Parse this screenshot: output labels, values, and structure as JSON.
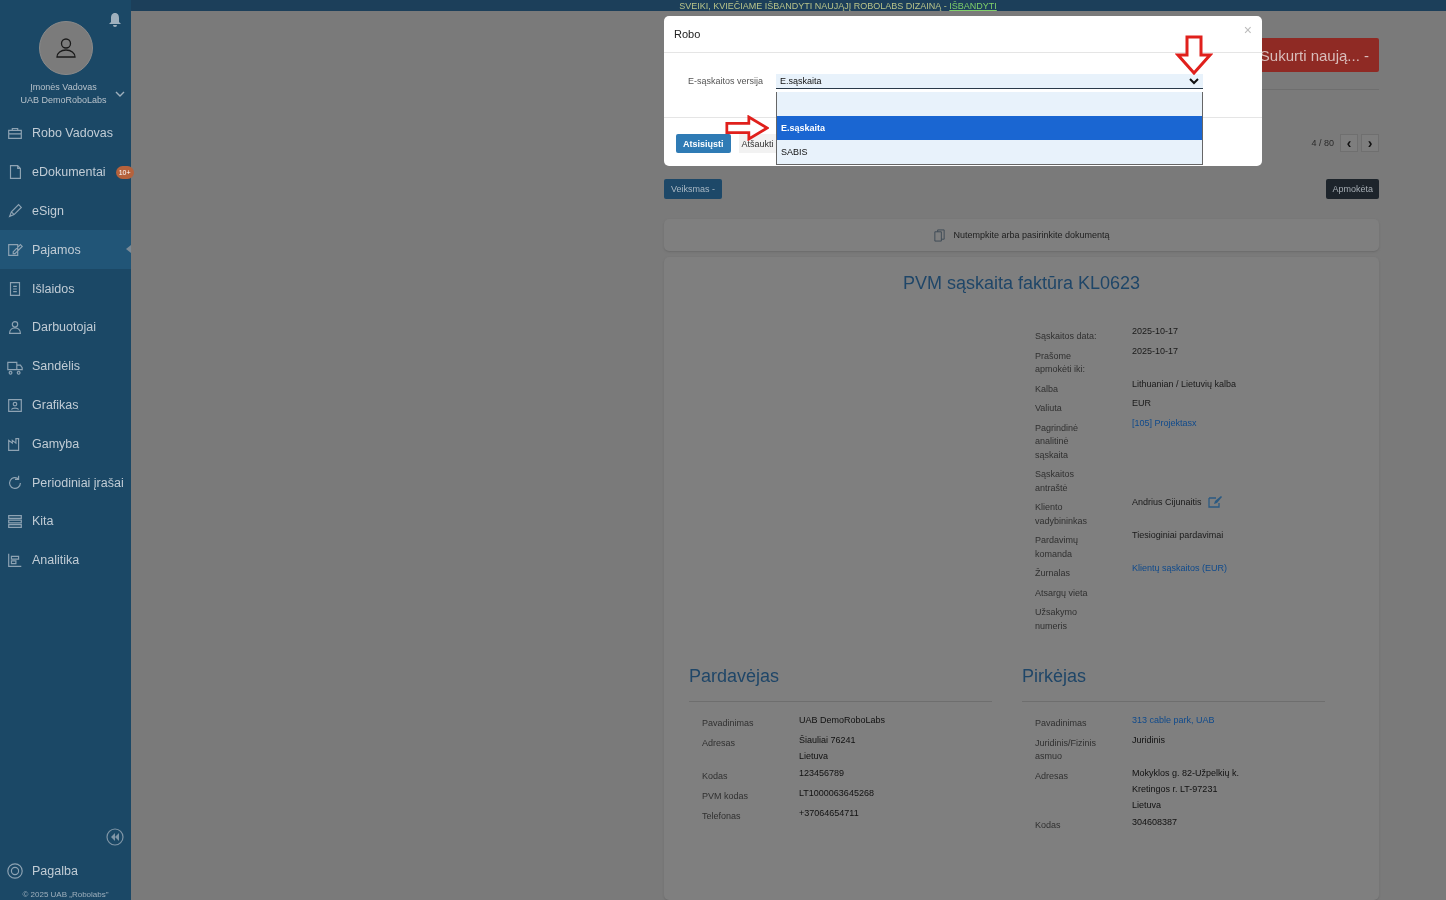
{
  "banner": {
    "text": "SVEIKI, KVIEČIAME IŠBANDYTI NAUJĄJĮ ROBOLABS DIZAINĄ - ",
    "link": "IŠBANDYTI"
  },
  "user": {
    "role": "Įmonės Vadovas",
    "company": "UAB DemoRoboLabs"
  },
  "sidebar": {
    "items": [
      {
        "label": "Robo Vadovas",
        "selected": false
      },
      {
        "label": "eDokumentai",
        "selected": false,
        "badge": "10+"
      },
      {
        "label": "eSign",
        "selected": false
      },
      {
        "label": "Pajamos",
        "selected": true
      },
      {
        "label": "Išlaidos",
        "selected": false
      },
      {
        "label": "Darbuotojai",
        "selected": false
      },
      {
        "label": "Sandėlis",
        "selected": false
      },
      {
        "label": "Grafikas",
        "selected": false
      },
      {
        "label": "Gamyba",
        "selected": false
      },
      {
        "label": "Periodiniai įrašai",
        "selected": false
      },
      {
        "label": "Kita",
        "selected": false
      },
      {
        "label": "Analitika",
        "selected": false
      }
    ],
    "help": "Pagalba",
    "copyright": "© 2025 UAB „Robolabs\""
  },
  "modal": {
    "title": "Robo",
    "close": "×",
    "field_label": "E-sąskaitos versija",
    "value": "E.sąskaita",
    "options": [
      {
        "label": "E.sąskaita",
        "selected": true
      },
      {
        "label": "SABIS",
        "selected": false
      }
    ],
    "buttons": [
      "Atsisiųsti",
      "Atšaukti"
    ]
  },
  "toolbar": {
    "create": "Sukurti naują... -",
    "pager": "4 / 80",
    "prev": "‹",
    "next": "›",
    "action": "Veiksmas -",
    "status": "Apmokėta"
  },
  "dropzone": "Nutempkite arba pasirinkite dokumentą",
  "invoice": {
    "title": "PVM sąskaita faktūra KL0623",
    "details": [
      {
        "label": "Sąskaitos data:",
        "value": "2025-10-17",
        "kind": "text"
      },
      {
        "label": "Prašome apmokėti iki:",
        "value": "2025-10-17",
        "kind": "text"
      },
      {
        "label": "Kalba",
        "value": "Lithuanian / Lietuvių kalba",
        "kind": "text"
      },
      {
        "label": "Valiuta",
        "value": "EUR",
        "kind": "text"
      },
      {
        "label": "Pagrindinė analitinė sąskaita",
        "value": "[105] Projektasx",
        "kind": "link"
      },
      {
        "label": "Sąskaitos antraštė",
        "kind": "text"
      },
      {
        "label": "Kliento vadybininkas",
        "value": "Andrius Cijunaitis",
        "kind": "editable"
      },
      {
        "label": "Pardavimų komanda",
        "value": "Tiesioginiai pardavimai",
        "kind": "text"
      },
      {
        "label": "Žurnalas",
        "value": "Klientų sąskaitos (EUR)",
        "kind": "link"
      },
      {
        "label": "Atsargų vieta",
        "kind": "text"
      },
      {
        "label": "Užsakymo numeris",
        "kind": "text"
      }
    ],
    "parties": [
      {
        "title": "Pardavėjas",
        "rows": [
          {
            "label": "Pavadinimas",
            "lines": [
              "UAB DemoRoboLabs"
            ],
            "kind": "text"
          },
          {
            "label": "Adresas",
            "lines": [
              "Šiauliai  76241",
              "Lietuva"
            ],
            "kind": "text"
          },
          {
            "label": "Kodas",
            "lines": [
              "123456789"
            ],
            "kind": "text"
          },
          {
            "label": "PVM kodas",
            "lines": [
              "LT1000063645268"
            ],
            "kind": "text"
          },
          {
            "label": "Telefonas",
            "lines": [
              "+37064654711"
            ],
            "kind": "text"
          }
        ]
      },
      {
        "title": "Pirkėjas",
        "rows": [
          {
            "label": "Pavadinimas",
            "lines": [
              "313 cable park, UAB"
            ],
            "kind": "link"
          },
          {
            "label": "Juridinis/Fizinis asmuo",
            "lines": [
              "Juridinis"
            ],
            "kind": "text"
          },
          {
            "label": "Adresas",
            "lines": [
              "Mokyklos g. 82-Užpelkių k.",
              "Kretingos r.  LT-97231",
              "Lietuva"
            ],
            "kind": "text"
          },
          {
            "label": "Kodas",
            "lines": [
              "304608387"
            ],
            "kind": "text"
          }
        ]
      }
    ]
  }
}
